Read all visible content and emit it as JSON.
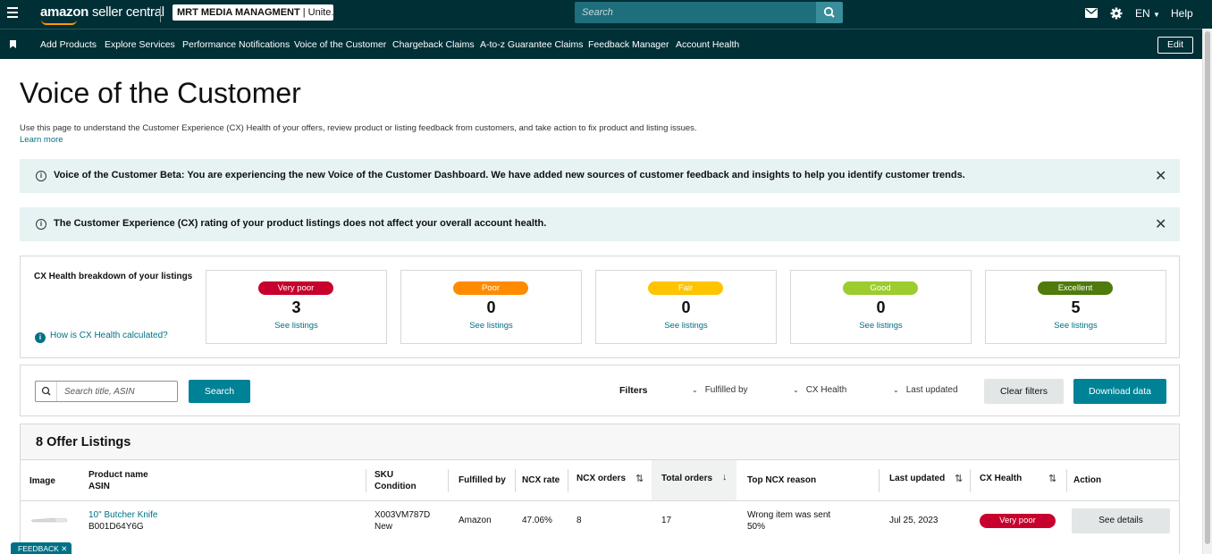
{
  "topbar": {
    "logo_main": "amazon",
    "logo_sub": "seller central",
    "account_name": "MRT MEDIA MANAGMENT",
    "account_region": "| Unite...",
    "search_placeholder": "Search",
    "language": "EN",
    "help_label": "Help"
  },
  "nav": {
    "items": [
      "Add Products",
      "Explore Services",
      "Performance Notifications",
      "Voice of the Customer",
      "Chargeback Claims",
      "A-to-z Guarantee Claims",
      "Feedback Manager",
      "Account Health"
    ],
    "edit_label": "Edit"
  },
  "page": {
    "title": "Voice of the Customer",
    "intro": "Use this page to understand the Customer Experience (CX) Health of your offers, review product or listing feedback from customers, and take action to fix product and listing issues.",
    "learn_more": "Learn more"
  },
  "banners": [
    {
      "message": "Voice of the Customer Beta: You are experiencing the new Voice of the Customer Dashboard. We have added new sources of customer feedback and insights to help you identify customer trends."
    },
    {
      "message": "The Customer Experience (CX) rating of your product listings does not affect your overall account health."
    }
  ],
  "cx_health": {
    "heading": "CX Health breakdown of your listings",
    "how_link": "How is CX Health calculated?",
    "cards": [
      {
        "label": "Very poor",
        "count": "3",
        "link": "See listings",
        "color": "#c7002d"
      },
      {
        "label": "Poor",
        "count": "0",
        "link": "See listings",
        "color": "#ff8c00"
      },
      {
        "label": "Fair",
        "count": "0",
        "link": "See listings",
        "color": "#ffc400"
      },
      {
        "label": "Good",
        "count": "0",
        "link": "See listings",
        "color": "#9ccc2e"
      },
      {
        "label": "Excellent",
        "count": "5",
        "link": "See listings",
        "color": "#4f7a0c"
      }
    ]
  },
  "filters": {
    "search_placeholder": "Search title, ASIN",
    "search_button": "Search",
    "filters_label": "Filters",
    "fulfilled_by": "Fulfilled by",
    "cx_health": "CX Health",
    "last_updated": "Last updated",
    "clear_button": "Clear filters",
    "download_button": "Download data"
  },
  "listings": {
    "title": "8 Offer Listings",
    "columns": {
      "image": "Image",
      "product_name": "Product name",
      "asin": "ASIN",
      "sku": "SKU",
      "condition": "Condition",
      "fulfilled_by": "Fulfilled by",
      "ncx_rate": "NCX rate",
      "ncx_orders": "NCX orders",
      "total_orders": "Total orders",
      "top_reason": "Top NCX reason",
      "last_updated": "Last updated",
      "cx_health": "CX Health",
      "action": "Action"
    },
    "rows": [
      {
        "product_name": "10\" Butcher Knife",
        "asin": "B001D64Y6G",
        "sku": "X003VM787D",
        "condition": "New",
        "fulfilled_by": "Amazon",
        "ncx_rate": "47.06%",
        "ncx_orders": "8",
        "total_orders": "17",
        "top_reason": "Wrong item was sent",
        "top_reason_pct": "50%",
        "last_updated": "Jul 25, 2023",
        "cx_health": "Very poor",
        "action": "See details"
      }
    ]
  },
  "feedback_tab": "FEEDBACK"
}
